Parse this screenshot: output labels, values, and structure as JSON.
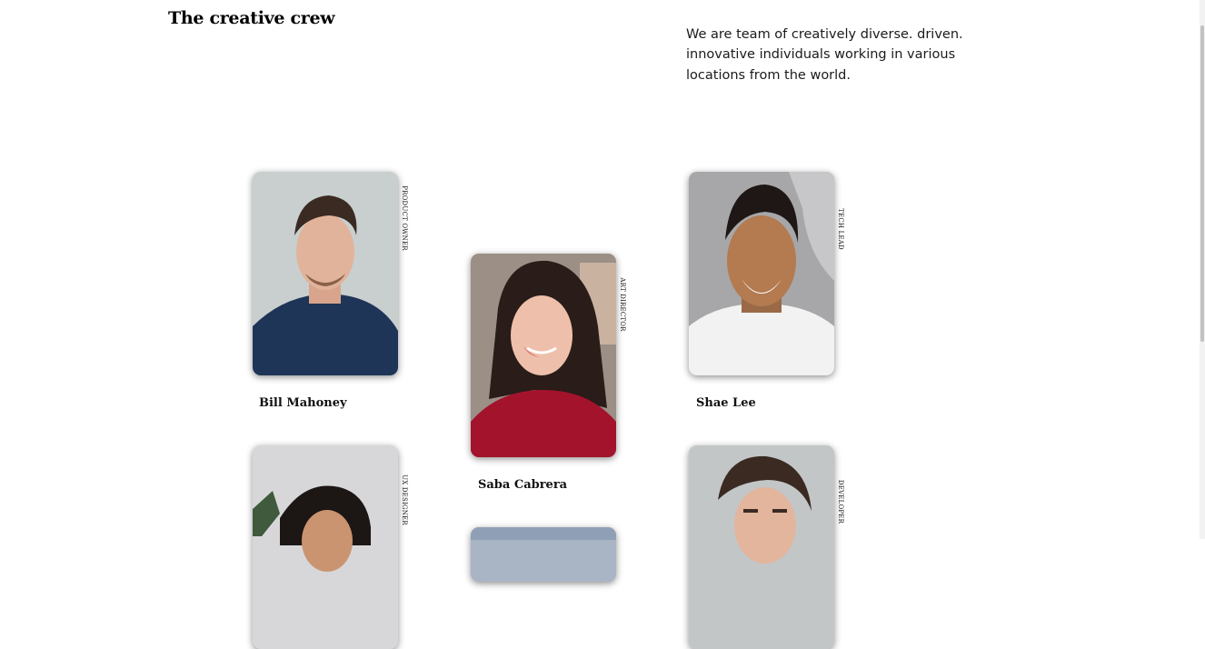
{
  "section": {
    "title": "The creative crew",
    "intro": "We are team of creatively diverse. driven. innovative individuals working in various locations from the world."
  },
  "team": [
    {
      "name": "Bill Mahoney",
      "role": "Product Owner"
    },
    {
      "name": "Saba Cabrera",
      "role": "Art Director"
    },
    {
      "name": "Shae Lee",
      "role": "Tech Lead"
    },
    {
      "name": "",
      "role": "UX Designer"
    },
    {
      "name": "",
      "role": "Developer"
    }
  ],
  "colors": {
    "background": "#ffffff",
    "text": "#000000"
  }
}
